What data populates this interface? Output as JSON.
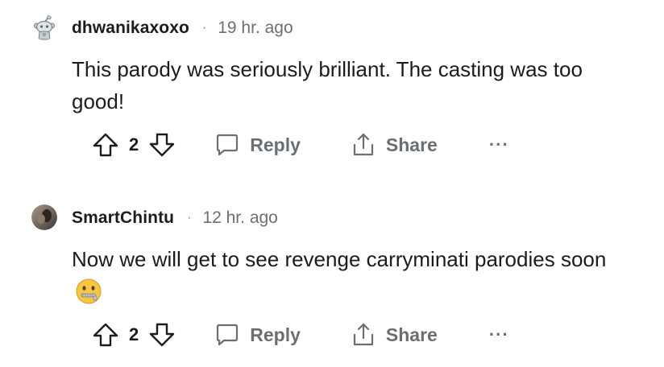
{
  "comments": [
    {
      "username": "dhwanikaxoxo",
      "separator": "·",
      "time": "19 hr. ago",
      "text": "This parody was seriously brilliant. The casting was too good!",
      "votes": "2",
      "reply_label": "Reply",
      "share_label": "Share",
      "more_label": "···",
      "avatar": "snoo-avatar"
    },
    {
      "username": "SmartChintu",
      "separator": "·",
      "time": "12 hr. ago",
      "text": "Now we will get to see revenge carryminati parodies soon",
      "emoji": "zipper-mouth-face",
      "votes": "2",
      "reply_label": "Reply",
      "share_label": "Share",
      "more_label": "···",
      "avatar": "photo-avatar"
    }
  ],
  "colors": {
    "text": "#1c1c1c",
    "muted": "#6a6f73",
    "background": "#ffffff"
  }
}
